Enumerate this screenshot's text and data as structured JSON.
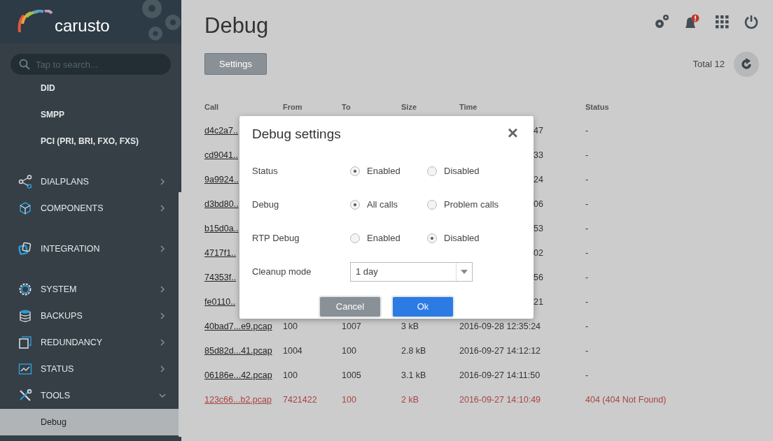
{
  "sidebar": {
    "logo": "carusto",
    "search": {
      "placeholder": "Tap to search..."
    },
    "groups": [
      {
        "items": [
          {
            "kind": "sublink",
            "label": "DID",
            "selected": false
          },
          {
            "kind": "sublink",
            "label": "SMPP",
            "selected": false
          },
          {
            "kind": "sublink",
            "label": "PCI (PRI, BRI, FXO, FXS)",
            "selected": false
          }
        ]
      },
      {
        "items": [
          {
            "kind": "section",
            "label": "DIALPLANS",
            "expanded": false
          },
          {
            "kind": "section",
            "label": "COMPONENTS",
            "expanded": false
          }
        ]
      },
      {
        "items": [
          {
            "kind": "section",
            "label": "INTEGRATION",
            "expanded": false
          }
        ]
      },
      {
        "items": [
          {
            "kind": "section",
            "label": "SYSTEM",
            "expanded": false
          },
          {
            "kind": "section",
            "label": "BACKUPS",
            "expanded": false
          },
          {
            "kind": "section",
            "label": "REDUNDANCY",
            "expanded": false
          },
          {
            "kind": "section",
            "label": "STATUS",
            "expanded": false
          },
          {
            "kind": "section",
            "label": "TOOLS",
            "expanded": true,
            "children": [
              {
                "label": "Debug",
                "selected": true
              }
            ]
          }
        ]
      }
    ]
  },
  "page": {
    "title": "Debug",
    "settings_button": "Settings",
    "total": "Total 12"
  },
  "table": {
    "columns": [
      "Call",
      "From",
      "To",
      "Size",
      "Time",
      "Status"
    ],
    "rows": [
      {
        "call": "d4c2a7..",
        "time": "47",
        "status": "-",
        "error": false
      },
      {
        "call": "cd9041..",
        "time": "33",
        "status": "-",
        "error": false
      },
      {
        "call": "9a9924..",
        "time": "24",
        "status": "-",
        "error": false
      },
      {
        "call": "d3bd80..",
        "time": "06",
        "status": "-",
        "error": false
      },
      {
        "call": "b15d0a..",
        "time": "53",
        "status": "-",
        "error": false
      },
      {
        "call": "4717f1..",
        "time": "02",
        "status": "-",
        "error": false
      },
      {
        "call": "74353f..",
        "time": "56",
        "status": "-",
        "error": false
      },
      {
        "call": "fe0110..",
        "time": "21",
        "status": "-",
        "error": false
      },
      {
        "call": "40bad7...e9.pcap",
        "from": "100",
        "to": "1007",
        "size": "3 kB",
        "time": "2016-09-28 12:35:24",
        "status": "-",
        "error": false
      },
      {
        "call": "85d82d...41.pcap",
        "from": "1004",
        "to": "100",
        "size": "2.8 kB",
        "time": "2016-09-27 14:12:12",
        "status": "-",
        "error": false
      },
      {
        "call": "06186e...42.pcap",
        "from": "100",
        "to": "1005",
        "size": "3.1 kB",
        "time": "2016-09-27 14:11:50",
        "status": "-",
        "error": false
      },
      {
        "call": "123c66...b2.pcap",
        "from": "7421422",
        "to": "100",
        "size": "2 kB",
        "time": "2016-09-27 14:10:49",
        "status": "404 (404 Not Found)",
        "error": true
      }
    ]
  },
  "dialog": {
    "title": "Debug settings",
    "close": "×",
    "rows": [
      {
        "kind": "radio",
        "label": "Status",
        "options": [
          {
            "label": "Enabled",
            "selected": true
          },
          {
            "label": "Disabled",
            "selected": false
          }
        ]
      },
      {
        "kind": "radio",
        "label": "Debug",
        "options": [
          {
            "label": "All calls",
            "selected": true
          },
          {
            "label": "Problem calls",
            "selected": false
          }
        ]
      },
      {
        "kind": "radio",
        "label": "RTP Debug",
        "options": [
          {
            "label": "Enabled",
            "selected": false
          },
          {
            "label": "Disabled",
            "selected": true
          }
        ]
      },
      {
        "kind": "select",
        "label": "Cleanup mode",
        "value": "1 day"
      }
    ],
    "buttons": [
      {
        "kind": "cancel",
        "label": "Cancel"
      },
      {
        "kind": "ok",
        "label": "Ok"
      }
    ]
  }
}
